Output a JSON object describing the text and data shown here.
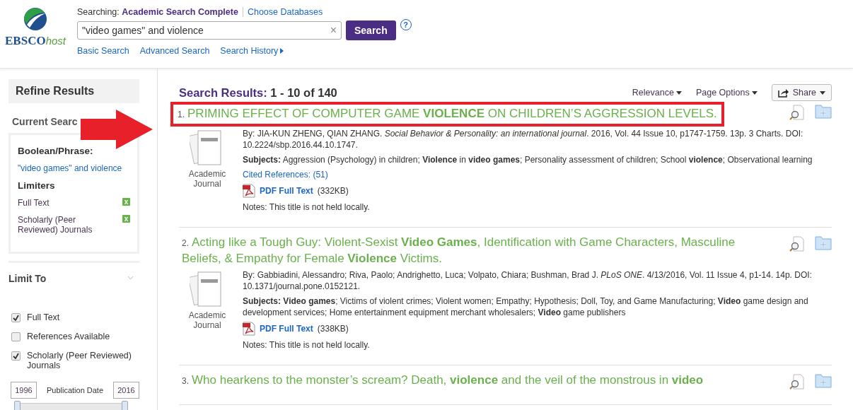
{
  "header": {
    "logo": {
      "brand": "EBSCO",
      "suffix": "host"
    },
    "searching_label": "Searching:",
    "database": "Academic Search Complete",
    "choose_databases": "Choose Databases",
    "query": "\"video games\" and violence",
    "clear": "×",
    "search_button": "Search",
    "help": "?",
    "links": [
      "Basic Search",
      "Advanced Search",
      "Search History"
    ]
  },
  "sidebar": {
    "title": "Refine Results",
    "current_search": {
      "heading": "Current Searc",
      "boolean_heading": "Boolean/Phrase:",
      "query": "\"video games\" and violence",
      "limiters_heading": "Limiters",
      "limiters": [
        {
          "label": "Full Text",
          "remove": "x"
        },
        {
          "label": "Scholarly (Peer Reviewed) Journals",
          "remove": "x"
        }
      ]
    },
    "limit_to": {
      "heading": "Limit To",
      "options": [
        {
          "label": "Full Text",
          "checked": true
        },
        {
          "label": "References Available",
          "checked": false
        },
        {
          "label": "Scholarly (Peer Reviewed) Journals",
          "checked": true
        }
      ],
      "date_from": "1996",
      "date_label": "Publication Date",
      "date_to": "2016",
      "date_slider": [
        {
          "level": 0
        },
        {
          "level": 1
        }
      ]
    }
  },
  "pointer_arrow": true,
  "results_header": {
    "label": "Search Results:",
    "range": "1 - 10 of 140",
    "sort": "Relevance",
    "page_options": "Page Options",
    "share": "Share"
  },
  "results": [
    {
      "number": "1.",
      "title": "PRIMING EFFECT OF COMPUTER GAME **VIOLENCE** ON CHILDREN’S AGGRESSION LEVELS.",
      "highlighted": true,
      "type": "Academic Journal",
      "byline": "By: JIA-KUN ZHENG, QIAN ZHANG. *Social Behavior & Personality: an international journal*. 2016, Vol. 44 Issue 10, p1747-1759. 13p. 3 Charts. DOI: 10.2224/sbp.2016.44.10.1747.",
      "subjects": "**Subjects:** Aggression (Psychology) in children; **Violence** in **video games**; Personality assessment of children; School **violence**; Observational learning",
      "cited": "Cited References: (51)",
      "pdf": "PDF Full Text",
      "pdf_size": "(332KB)",
      "notes": "Notes:  This title is not held locally."
    },
    {
      "number": "2.",
      "title": "Acting like a Tough Guy: Violent-Sexist **Video Games**, Identification with Game Characters, Masculine Beliefs, & Empathy for Female **Violence** Victims.",
      "highlighted": false,
      "type": "Academic Journal",
      "byline": "By: Gabbiadini, Alessandro; Riva, Paolo; Andrighetto, Luca; Volpato, Chiara; Bushman, Brad J. *PLoS ONE*. 4/13/2016, Vol. 11 Issue 4, p1-14. 14p. DOI: 10.1371/journal.pone.0152121.",
      "subjects": "**Subjects: Video games**; Victims of violent crimes; Violent women; Empathy; Hypothesis; Doll, Toy, and Game Manufacturing; **Video** game design and development services; Home entertainment equipment merchant wholesalers; **Video** game publishers",
      "pdf": "PDF Full Text",
      "pdf_size": "(338KB)",
      "notes": "Notes:  This title is not held locally."
    },
    {
      "number": "3.",
      "title": "Who hearkens to the monster’s scream? Death, **violence** and the veil of the monstrous in **video**",
      "highlighted": false
    }
  ]
}
